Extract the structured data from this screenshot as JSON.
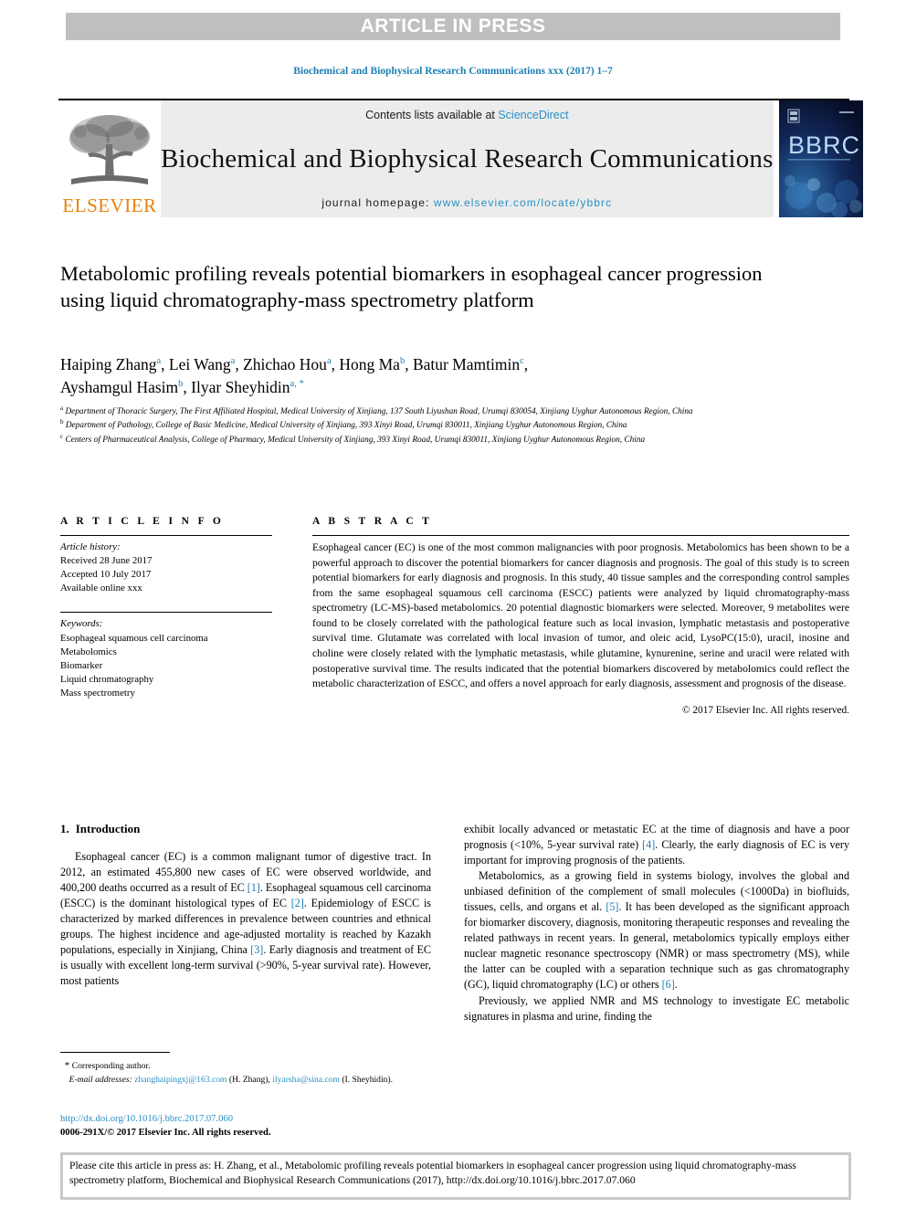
{
  "banner": {
    "text": "ARTICLE IN PRESS"
  },
  "running_head": "Biochemical and Biophysical Research Communications xxx (2017) 1–7",
  "masthead": {
    "contents_prefix": "Contents lists available at ",
    "contents_link": "ScienceDirect",
    "journal_name": "Biochemical and Biophysical Research Communications",
    "homepage_prefix": "journal homepage: ",
    "homepage_url": "www.elsevier.com/locate/ybbrc",
    "publisher_logo_word": "ELSEVIER",
    "cover_title": "BBRC"
  },
  "article": {
    "title": "Metabolomic profiling reveals potential biomarkers in esophageal cancer progression using liquid chromatography-mass spectrometry platform",
    "authors_line1_a": "Haiping Zhang",
    "authors_line1_a_sup": "a",
    "authors_line1_b": "Lei Wang",
    "authors_line1_b_sup": "a",
    "authors_line1_c": "Zhichao Hou",
    "authors_line1_c_sup": "a",
    "authors_line1_d": "Hong Ma",
    "authors_line1_d_sup": "b",
    "authors_line1_e": "Batur Mamtimin",
    "authors_line1_e_sup": "c",
    "authors_line2_a": "Ayshamgul Hasim",
    "authors_line2_a_sup": "b",
    "authors_line2_b": "Ilyar Sheyhidin",
    "authors_line2_b_sup": "a, *",
    "affiliations": [
      {
        "marker": "a",
        "text": "Department of Thoracic Surgery, The First Affiliated Hospital, Medical University of Xinjiang, 137 South Liyushan Road, Urumqi 830054, Xinjiang Uyghur Autonomous Region, China"
      },
      {
        "marker": "b",
        "text": "Department of Pathology, College of Basic Medicine, Medical University of Xinjiang, 393 Xinyi Road, Urumqi 830011, Xinjiang Uyghur Autonomous Region, China"
      },
      {
        "marker": "c",
        "text": "Centers of Pharmaceutical Analysis, College of Pharmacy, Medical University of Xinjiang, 393 Xinyi Road, Urumqi 830011, Xinjiang Uyghur Autonomous Region, China"
      }
    ]
  },
  "article_info": {
    "heading": "A R T I C L E  I N F O",
    "history_label": "Article history:",
    "received": "Received 28 June 2017",
    "accepted": "Accepted 10 July 2017",
    "available": "Available online xxx",
    "keywords_label": "Keywords:",
    "keywords": [
      "Esophageal squamous cell carcinoma",
      "Metabolomics",
      "Biomarker",
      "Liquid chromatography",
      "Mass spectrometry"
    ]
  },
  "abstract": {
    "heading": "A B S T R A C T",
    "text": "Esophageal cancer (EC) is one of the most common malignancies with poor prognosis. Metabolomics has been shown to be a powerful approach to discover the potential biomarkers for cancer diagnosis and prognosis. The goal of this study is to screen potential biomarkers for early diagnosis and prognosis. In this study, 40 tissue samples and the corresponding control samples from the same esophageal squamous cell carcinoma (ESCC) patients were analyzed by liquid chromatography-mass spectrometry (LC-MS)-based metabolomics. 20 potential diagnostic biomarkers were selected. Moreover, 9 metabolites were found to be closely correlated with the pathological feature such as local invasion, lymphatic metastasis and postoperative survival time. Glutamate was correlated with local invasion of tumor, and oleic acid, LysoPC(15:0), uracil, inosine and choline were closely related with the lymphatic metastasis, while glutamine, kynurenine, serine and uracil were related with postoperative survival time. The results indicated that the potential biomarkers discovered by metabolomics could reflect the metabolic characterization of ESCC, and offers a novel approach for early diagnosis, assessment and prognosis of the disease.",
    "copyright": "© 2017 Elsevier Inc. All rights reserved."
  },
  "introduction": {
    "number": "1.",
    "heading": "Introduction",
    "left_p1_pre": "Esophageal cancer (EC) is a common malignant tumor of digestive tract. In 2012, an estimated 455,800 new cases of EC were observed worldwide, and 400,200 deaths occurred as a result of EC ",
    "left_ref1": "[1]",
    "left_p1_mid": ". Esophageal squamous cell carcinoma (ESCC) is the dominant histological types of EC ",
    "left_ref2": "[2]",
    "left_p1_mid2": ". Epidemiology of ESCC is characterized by marked differences in prevalence between countries and ethnical groups. The highest incidence and age-adjusted mortality is reached by Kazakh populations, especially in Xinjiang, China ",
    "left_ref3": "[3]",
    "left_p1_end": ". Early diagnosis and treatment of EC is usually with excellent long-term survival (>90%, 5-year survival rate). However, most patients",
    "right_p1_pre": "exhibit locally advanced or metastatic EC at the time of diagnosis and have a poor prognosis (<10%, 5-year survival rate) ",
    "right_ref4": "[4]",
    "right_p1_end": ". Clearly, the early diagnosis of EC is very important for improving prognosis of the patients.",
    "right_p2_pre": "Metabolomics, as a growing field in systems biology, involves the global and unbiased definition of the complement of small molecules (<1000Da) in biofluids, tissues, cells, and organs et al. ",
    "right_ref5": "[5]",
    "right_p2_mid": ". It has been developed as the significant approach for biomarker discovery, diagnosis, monitoring therapeutic responses and revealing the related pathways in recent years. In general, metabolomics typically employs either nuclear magnetic resonance spectroscopy (NMR) or mass spectrometry (MS), while the latter can be coupled with a separation technique such as gas chromatography (GC), liquid chromatography (LC) or others ",
    "right_ref6": "[6]",
    "right_p2_end": ".",
    "right_p3": "Previously, we applied NMR and MS technology to investigate EC metabolic signatures in plasma and urine, finding the"
  },
  "footnote": {
    "corresponding": "Corresponding author.",
    "email_label": "E-mail addresses:",
    "email1": "zhanghaipingxj@163.com",
    "email1_owner": "(H. Zhang),",
    "email2": "ilyarsha@sina.com",
    "email2_owner": "(I. Sheyhidin).",
    "doi_url": "http://dx.doi.org/10.1016/j.bbrc.2017.07.060",
    "issn_line": "0006-291X/© 2017 Elsevier Inc. All rights reserved."
  },
  "citation_box": {
    "text": "Please cite this article in press as: H. Zhang, et al., Metabolomic profiling reveals potential biomarkers in esophageal cancer progression using liquid chromatography-mass spectrometry platform, Biochemical and Biophysical Research Communications (2017), http://dx.doi.org/10.1016/j.bbrc.2017.07.060"
  },
  "colors": {
    "link": "#2a8fc4",
    "reference": "#1a7fb5",
    "banner_bg": "#bfbfbf",
    "masthead_bg": "#ececec",
    "elsevier_orange": "#e8820c"
  }
}
